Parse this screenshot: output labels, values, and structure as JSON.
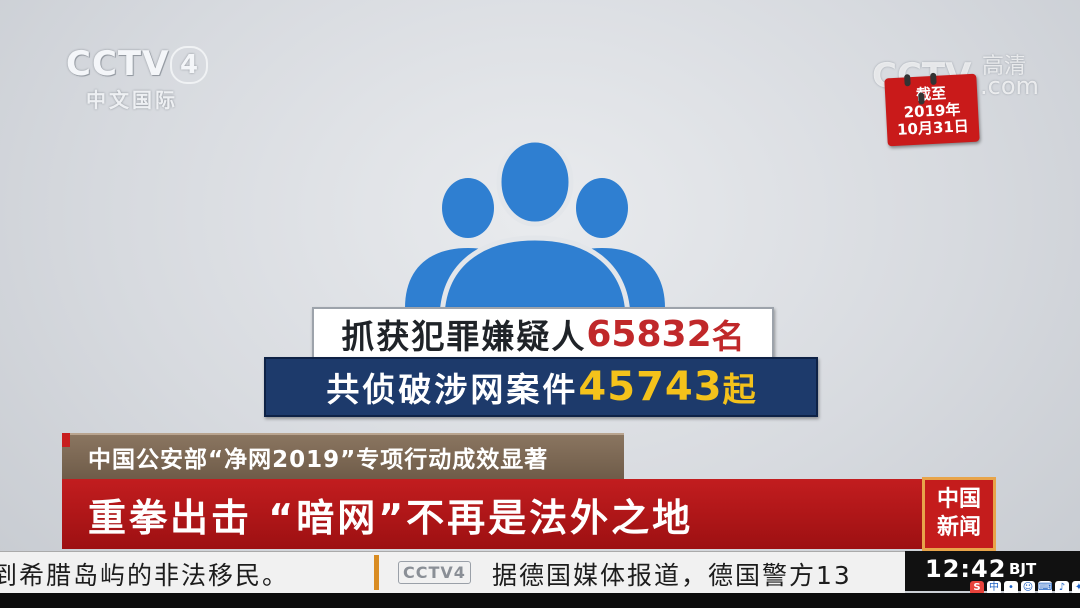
{
  "channel_logo": {
    "brand": "CCTV",
    "number": "4",
    "sub": "中文国际"
  },
  "hd_watermark": {
    "brand": "CCTV",
    "hd": "高清",
    "com": ".com"
  },
  "date_badge": {
    "line1": "截至",
    "line2": "2019年",
    "line3": "10月31日"
  },
  "stats": {
    "suspects": {
      "label": "抓获犯罪嫌疑人",
      "value": "65832",
      "unit": "名"
    },
    "cases": {
      "label": "共侦破涉网案件",
      "value": "45743",
      "unit": "起"
    }
  },
  "subtitle": "中国公安部“净网2019”专项行动成效显著",
  "headline": "重拳出击 “暗网”不再是法外之地",
  "program_logo": {
    "line1": "中国",
    "line2": "新闻"
  },
  "ticker": {
    "left_text": "到希腊岛屿的非法移民。",
    "logo": "CCTV4",
    "right_text": "据德国媒体报道，德国警方13"
  },
  "clock": {
    "time": "12:42",
    "zone": "BJT"
  },
  "colors": {
    "banner_red": "#c21d1f",
    "stat_navy": "#1d3a6b",
    "accent_gold": "#f4c21b",
    "icon_blue": "#2f7fd1"
  }
}
